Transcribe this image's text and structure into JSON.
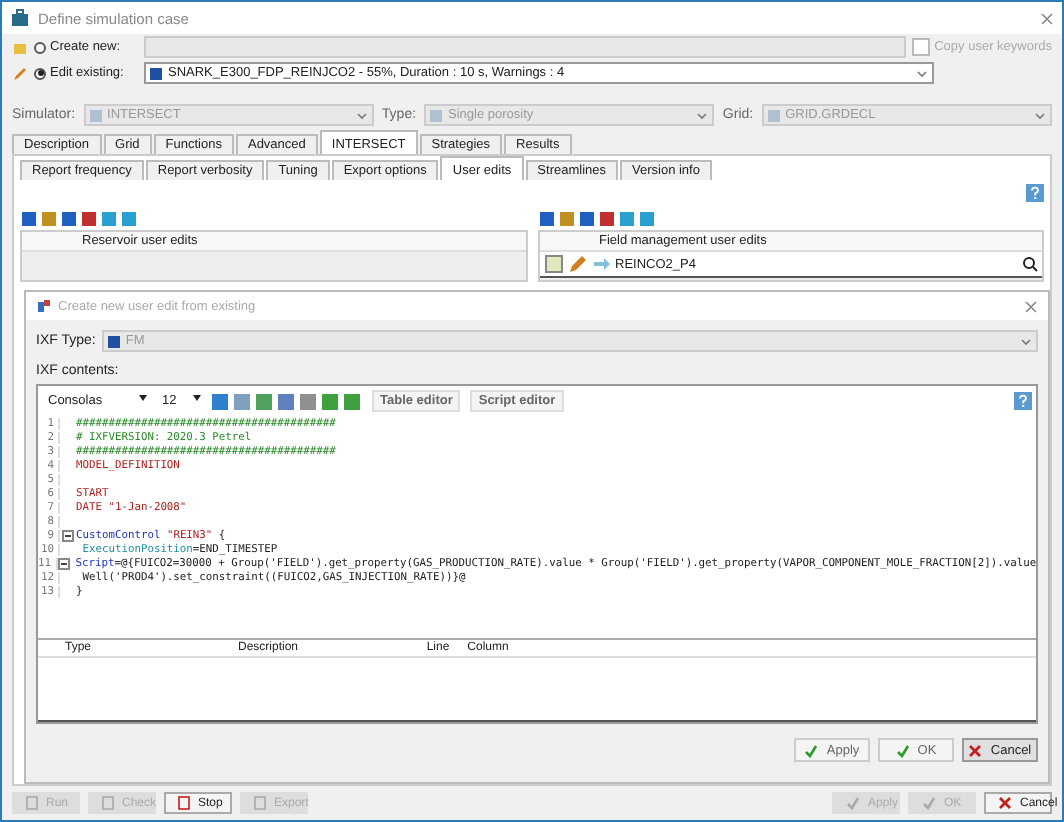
{
  "window": {
    "title": "Define simulation case"
  },
  "case": {
    "create_new": {
      "label": "Create new:",
      "selected": false
    },
    "edit_existing": {
      "label": "Edit existing:",
      "selected": true,
      "value": "SNARK_E300_FDP_REINJCO2 - 55%, Duration : 10 s, Warnings : 4"
    },
    "copy_user_keywords": {
      "label": "Copy user keywords",
      "checked": false
    }
  },
  "settings": [
    {
      "label": "Simulator:",
      "value": "INTERSECT"
    },
    {
      "label": "Type:",
      "value": "Single porosity"
    },
    {
      "label": "Grid:",
      "value": "GRID.GRDECL"
    }
  ],
  "tabs": [
    {
      "label": "Description",
      "selected": false
    },
    {
      "label": "Grid",
      "selected": false
    },
    {
      "label": "Functions",
      "selected": false
    },
    {
      "label": "Advanced",
      "selected": false
    },
    {
      "label": "INTERSECT",
      "selected": true
    },
    {
      "label": "Strategies",
      "selected": false
    },
    {
      "label": "Results",
      "selected": false
    }
  ],
  "subtabs": [
    {
      "label": "Report frequency",
      "selected": false
    },
    {
      "label": "Report verbosity",
      "selected": false
    },
    {
      "label": "Tuning",
      "selected": false
    },
    {
      "label": "Export options",
      "selected": false
    },
    {
      "label": "User edits",
      "selected": true
    },
    {
      "label": "Streamlines",
      "selected": false
    },
    {
      "label": "Version info",
      "selected": false
    }
  ],
  "reservoir_edits": {
    "heading": "Reservoir user edits"
  },
  "field_edits": {
    "heading": "Field management user edits",
    "item": "REINCO2_P4"
  },
  "dialog": {
    "title": "Create new user edit from existing",
    "ixf_type_label": "IXF Type:",
    "ixf_type": "FM",
    "contents_label": "IXF contents:",
    "font": "Consolas",
    "size": "12",
    "table_editor": "Table editor",
    "script_editor": "Script editor",
    "code": [
      {
        "number": "1",
        "fold": false,
        "segments": [
          {
            "text": "########################################",
            "kind": "comment"
          }
        ]
      },
      {
        "number": "2",
        "fold": false,
        "segments": [
          {
            "text": "# IXFVERSION: 2020.3 Petrel",
            "kind": "comment"
          }
        ]
      },
      {
        "number": "3",
        "fold": false,
        "segments": [
          {
            "text": "########################################",
            "kind": "comment"
          }
        ]
      },
      {
        "number": "4",
        "fold": false,
        "segments": [
          {
            "text": "MODEL_DEFINITION",
            "kind": "keyword"
          }
        ]
      },
      {
        "number": "5",
        "fold": false
      },
      {
        "number": "6",
        "fold": false,
        "segments": [
          {
            "text": "START",
            "kind": "keyword"
          }
        ]
      },
      {
        "number": "7",
        "fold": false,
        "segments": [
          {
            "text": "DATE \"1-Jan-2008\"",
            "kind": "keyword"
          }
        ]
      },
      {
        "number": "8",
        "fold": false
      },
      {
        "number": "9",
        "fold": true,
        "segments": [
          {
            "text": "CustomControl",
            "kind": "type"
          },
          {
            "text": " \"REIN3\"",
            "kind": "keyword"
          },
          {
            "text": " {",
            "kind": "plain"
          }
        ]
      },
      {
        "number": "10",
        "fold": false,
        "segments": [
          {
            "text": " ExecutionPosition",
            "kind": "property"
          },
          {
            "text": "=END_TIMESTEP",
            "kind": "plain"
          }
        ]
      },
      {
        "number": "11",
        "fold": true,
        "segments": [
          {
            "text": " Script",
            "kind": "type"
          },
          {
            "text": "=@{FUICO2=30000 + Group('FIELD').get_property(GAS_PRODUCTION_RATE).value * Group('FIELD').get_property(VAPOR_COMPONENT_MOLE_FRACTION[2]).value",
            "kind": "plain"
          }
        ]
      },
      {
        "number": "12",
        "fold": false,
        "segments": [
          {
            "text": " Well('PROD4').set_constraint((FUICO2,GAS_INJECTION_RATE))}@",
            "kind": "plain"
          }
        ]
      },
      {
        "number": "13",
        "fold": false,
        "segments": [
          {
            "text": "}",
            "kind": "plain"
          }
        ]
      }
    ],
    "error_columns": [
      "Type",
      "Description",
      "Line",
      "Column"
    ],
    "buttons": [
      {
        "label": "Apply",
        "kind": "ok",
        "disabled": false
      },
      {
        "label": "OK",
        "kind": "ok",
        "disabled": false
      },
      {
        "label": "Cancel",
        "kind": "cancel",
        "disabled": false
      }
    ]
  },
  "bottom_buttons": [
    {
      "label": "Run",
      "kind": "run",
      "disabled": true
    },
    {
      "label": "Check",
      "kind": "check",
      "disabled": true
    },
    {
      "label": "Stop",
      "kind": "stop",
      "disabled": false
    },
    {
      "label": "Export",
      "kind": "export",
      "disabled": true
    },
    {
      "label": "Apply",
      "kind": "ok",
      "disabled": true
    },
    {
      "label": "OK",
      "kind": "ok",
      "disabled": true
    },
    {
      "label": "Cancel",
      "kind": "cancel",
      "disabled": false
    }
  ]
}
